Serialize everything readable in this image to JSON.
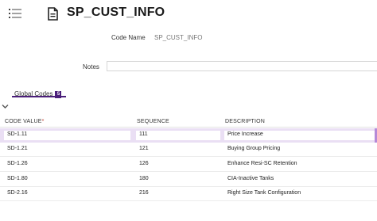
{
  "header": {
    "title": "SP_CUST_INFO",
    "menu_icon": "list-icon",
    "doc_icon": "document-icon"
  },
  "fields": {
    "code_name_label": "Code Name",
    "code_name_value": "SP_CUST_INFO",
    "notes_label": "Notes",
    "notes_value": ""
  },
  "tabs": [
    {
      "label": "Global Codes",
      "badge": "5",
      "active": true
    }
  ],
  "colors": {
    "accent": "#4b1f7a",
    "selected_row": "#eadff4"
  },
  "grid": {
    "headers": {
      "code_value": "CODE VALUE",
      "required_mark": "*",
      "sequence": "SEQUENCE",
      "description": "DESCRIPTION"
    },
    "rows": [
      {
        "code": "SD-1.11",
        "sequence": "111",
        "description": "Price Increase",
        "selected": true
      },
      {
        "code": "SD-1.21",
        "sequence": "121",
        "description": "Buying Group Pricing",
        "selected": false
      },
      {
        "code": "SD-1.26",
        "sequence": "126",
        "description": "Enhance Resi-SC Retention",
        "selected": false
      },
      {
        "code": "SD-1.80",
        "sequence": "180",
        "description": "CIA-Inactive Tanks",
        "selected": false
      },
      {
        "code": "SD-2.16",
        "sequence": "216",
        "description": "Right Size Tank Configuration",
        "selected": false
      }
    ]
  }
}
